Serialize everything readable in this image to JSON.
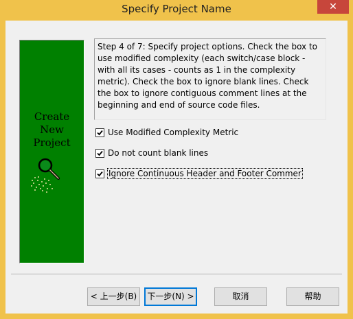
{
  "window": {
    "title": "Specify Project Name",
    "close_label": "✕"
  },
  "art_panel": {
    "lines": [
      "Create",
      "New",
      "Project"
    ]
  },
  "description": "Step 4 of 7: Specify project options. Check the box to use modified complexity (each switch/case block - with all its cases - counts as 1 in the complexity metric). Check the box to ignore blank lines. Check the box to ignore contiguous comment lines at the beginning and end of source code files.",
  "options": [
    {
      "label": "Use Modified Complexity Metric",
      "checked": true
    },
    {
      "label": "Do not count blank lines",
      "checked": true
    },
    {
      "label": "Ignore Continuous Header and Footer Commer",
      "checked": true
    }
  ],
  "buttons": {
    "back": "< 上一步(B)",
    "next": "下一步(N) >",
    "cancel": "取消",
    "help": "帮助"
  },
  "colors": {
    "titlebar": "#f0c24b",
    "art_background": "#008000",
    "close_button": "#c7463b"
  }
}
